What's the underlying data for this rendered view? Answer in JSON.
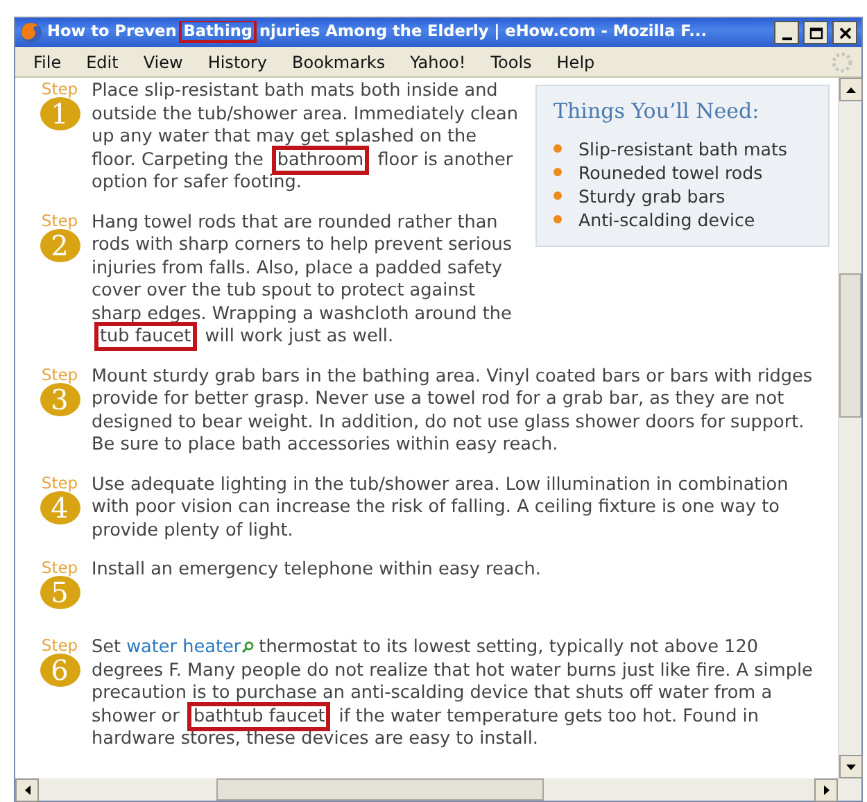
{
  "window": {
    "title_segments": [
      {
        "kind": "plain",
        "text": "How to Preven"
      },
      {
        "kind": "highlight",
        "text": "Bathing"
      },
      {
        "kind": "plain",
        "text": "njuries Among the Elderly | eHow.com - Mozilla F..."
      }
    ]
  },
  "menu": [
    "File",
    "Edit",
    "View",
    "History",
    "Bookmarks",
    "Yahoo!",
    "Tools",
    "Help"
  ],
  "sidebar": {
    "title": "Things You’ll Need:",
    "items": [
      "Slip-resistant bath mats",
      "Rouneded towel rods",
      "Sturdy grab bars",
      "Anti-scalding device"
    ]
  },
  "steps": [
    {
      "label": "Step",
      "number": "1",
      "segments": [
        {
          "kind": "plain",
          "text": "Place slip-resistant bath mats both inside and outside the tub/shower area. Immediately clean up any water that may get splashed on the floor. Carpeting the "
        },
        {
          "kind": "highlight",
          "text": "bathroom"
        },
        {
          "kind": "plain",
          "text": " floor is another option for safer footing."
        }
      ]
    },
    {
      "label": "Step",
      "number": "2",
      "segments": [
        {
          "kind": "plain",
          "text": "Hang towel rods that are rounded rather than rods with sharp corners to help prevent serious injuries from falls. Also, place a padded safety cover over the tub spout to protect against sharp edges. Wrapping a washcloth around the "
        },
        {
          "kind": "highlight",
          "text": "tub faucet"
        },
        {
          "kind": "plain",
          "text": " will work just as well."
        }
      ]
    },
    {
      "label": "Step",
      "number": "3",
      "segments": [
        {
          "kind": "plain",
          "text": "Mount sturdy grab bars in the bathing area. Vinyl coated bars or bars with ridges provide for better grasp. Never use a towel rod for a grab bar, as they are not designed to bear weight. In addition, do not use glass shower doors for support. Be sure to place bath accessories within easy reach."
        }
      ]
    },
    {
      "label": "Step",
      "number": "4",
      "segments": [
        {
          "kind": "plain",
          "text": "Use adequate lighting in the tub/shower area. Low illumination in combination with poor vision can increase the risk of falling. A ceiling fixture is one way to provide plenty of light."
        }
      ]
    },
    {
      "label": "Step",
      "number": "5",
      "segments": [
        {
          "kind": "plain",
          "text": "Install an emergency telephone within easy reach."
        }
      ]
    },
    {
      "label": "Step",
      "number": "6",
      "segments": [
        {
          "kind": "plain",
          "text": "Set "
        },
        {
          "kind": "link",
          "text": "water heater"
        },
        {
          "kind": "plain",
          "text": " thermostat to its lowest setting, typically not above 120 degrees F. Many people do not realize that hot water burns just like fire. A simple precaution is to purchase an anti-scalding device that shuts off water from a shower or "
        },
        {
          "kind": "highlight",
          "text": "bathtub faucet"
        },
        {
          "kind": "plain",
          "text": " if the water temperature gets too hot. Found in hardware stores, these devices are easy to install."
        }
      ]
    }
  ]
}
